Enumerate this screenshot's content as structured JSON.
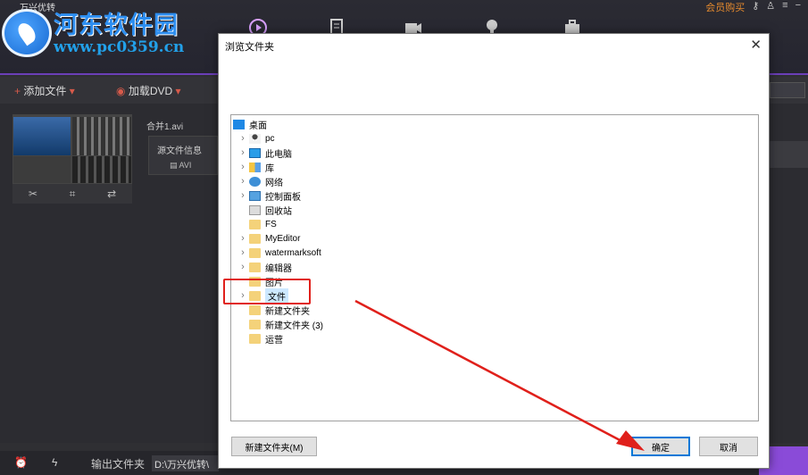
{
  "app": {
    "logo_text": "万兴优转",
    "topright": {
      "member": "会员购买",
      "icons": [
        "key-icon",
        "user-icon",
        "menu-icon",
        "minimize-icon"
      ]
    },
    "toolbar": {
      "add_file": "添加文件",
      "load_dvd": "加载DVD"
    },
    "clip": {
      "name": "合并1.avi",
      "source_info": "源文件信息",
      "format": "AVI",
      "tools": [
        "cut-icon",
        "crop-icon",
        "adjust-icon"
      ]
    },
    "bottom": {
      "output_label": "输出文件夹",
      "output_path": "D:\\万兴优转\\"
    },
    "accent": "#6b3fb8"
  },
  "watermark": {
    "title": "河东软件园",
    "url": "www.pc0359.cn"
  },
  "dialog": {
    "title": "浏览文件夹",
    "tree": [
      {
        "label": "桌面",
        "icon": "desktop-icon",
        "expandable": false,
        "selected": false
      },
      {
        "label": "pc",
        "icon": "user-icon",
        "expandable": true,
        "selected": false
      },
      {
        "label": "此电脑",
        "icon": "computer-icon",
        "expandable": true,
        "selected": false
      },
      {
        "label": "库",
        "icon": "library-icon",
        "expandable": true,
        "selected": false
      },
      {
        "label": "网络",
        "icon": "network-icon",
        "expandable": true,
        "selected": false
      },
      {
        "label": "控制面板",
        "icon": "control-panel-icon",
        "expandable": true,
        "selected": false
      },
      {
        "label": "回收站",
        "icon": "recycle-bin-icon",
        "expandable": false,
        "selected": false
      },
      {
        "label": "FS",
        "icon": "folder-icon",
        "expandable": false,
        "selected": false
      },
      {
        "label": "MyEditor",
        "icon": "folder-icon",
        "expandable": true,
        "selected": false
      },
      {
        "label": "watermarksoft",
        "icon": "folder-icon",
        "expandable": true,
        "selected": false
      },
      {
        "label": "编辑器",
        "icon": "folder-icon",
        "expandable": true,
        "selected": false
      },
      {
        "label": "图片",
        "icon": "folder-icon",
        "expandable": false,
        "selected": false
      },
      {
        "label": "文件",
        "icon": "folder-icon",
        "expandable": true,
        "selected": true
      },
      {
        "label": "新建文件夹",
        "icon": "folder-icon",
        "expandable": false,
        "selected": false
      },
      {
        "label": "新建文件夹 (3)",
        "icon": "folder-icon",
        "expandable": false,
        "selected": false
      },
      {
        "label": "运营",
        "icon": "folder-icon",
        "expandable": false,
        "selected": false
      }
    ],
    "new_folder_button": "新建文件夹(M)",
    "ok_button": "确定",
    "cancel_button": "取消"
  },
  "annotation": {
    "highlight_color": "#e0201b"
  }
}
